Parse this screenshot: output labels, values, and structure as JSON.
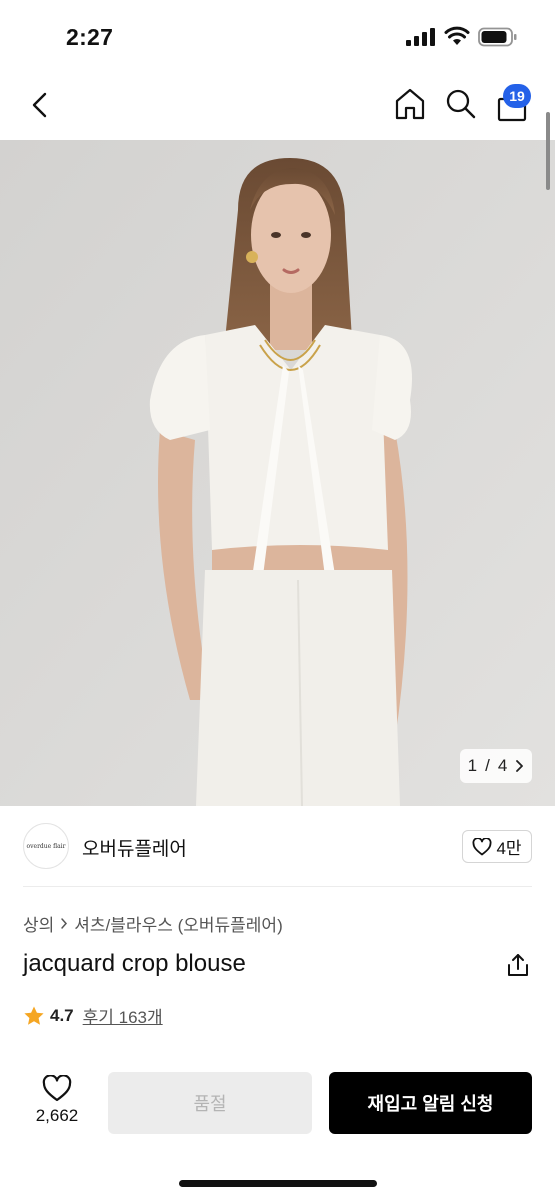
{
  "status_bar": {
    "time": "2:27"
  },
  "nav": {
    "cart_count": "19"
  },
  "gallery": {
    "current": "1",
    "separator": "/",
    "total": "4"
  },
  "brand": {
    "logo_text": "overdue flair",
    "name": "오버듀플레어",
    "likes": "4만"
  },
  "breadcrumb": {
    "level1": "상의",
    "level2": "셔츠/블라우스 (오버듀플레어)"
  },
  "product": {
    "title": "jacquard crop blouse",
    "rating": "4.7",
    "reviews_label": "후기 163개"
  },
  "bottom_bar": {
    "wish_count": "2,662",
    "soldout_label": "품절",
    "restock_label": "재입고 알림 신청"
  },
  "colors": {
    "accent_badge": "#2461e8",
    "star": "#f5a623",
    "primary_button": "#000000"
  }
}
